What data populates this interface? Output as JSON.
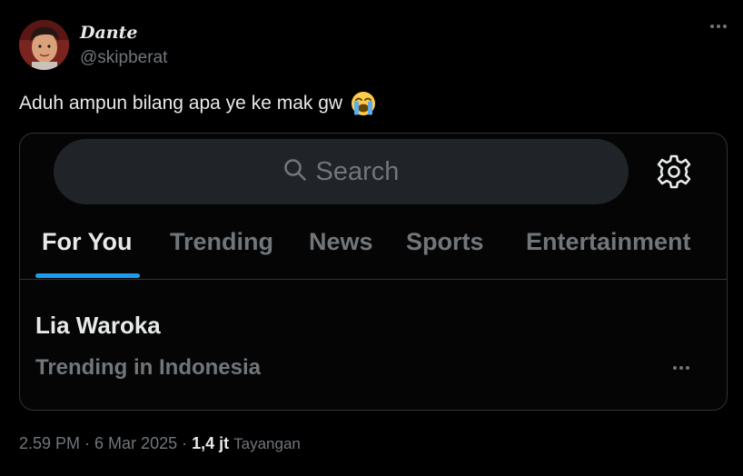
{
  "author": {
    "display_name": "Dante",
    "handle": "@skipberat"
  },
  "tweet": {
    "text": "Aduh ampun bilang apa ye ke mak gw",
    "emoji": "loudly-crying-face"
  },
  "card": {
    "search_placeholder": "Search",
    "tabs": [
      {
        "label": "For You",
        "active": true
      },
      {
        "label": "Trending",
        "active": false
      },
      {
        "label": "News",
        "active": false
      },
      {
        "label": "Sports",
        "active": false
      },
      {
        "label": "Entertainment",
        "active": false
      }
    ],
    "trend": {
      "title": "Lia Waroka",
      "context": "Trending in Indonesia"
    }
  },
  "meta": {
    "time": "2.59 PM",
    "date": "6 Mar 2025",
    "separator": "·",
    "views_count": "1,4 jt",
    "views_label": "Tayangan"
  },
  "colors": {
    "background": "#000000",
    "text_primary": "#e7e9ea",
    "text_secondary": "#71767b",
    "accent": "#1d9bf0",
    "border": "#2f3336",
    "search_bg": "#202327"
  }
}
